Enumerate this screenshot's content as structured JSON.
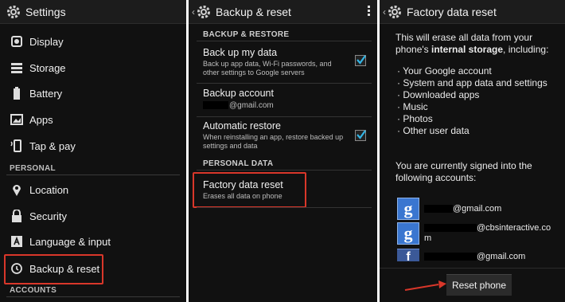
{
  "settings": {
    "title": "Settings",
    "items_top": [
      {
        "label": "Display",
        "icon": "display-icon"
      },
      {
        "label": "Storage",
        "icon": "storage-icon"
      },
      {
        "label": "Battery",
        "icon": "battery-icon"
      },
      {
        "label": "Apps",
        "icon": "apps-icon"
      },
      {
        "label": "Tap & pay",
        "icon": "tap-pay-icon"
      }
    ],
    "personal_header": "PERSONAL",
    "items_personal": [
      {
        "label": "Location",
        "icon": "location-icon"
      },
      {
        "label": "Security",
        "icon": "lock-icon"
      },
      {
        "label": "Language & input",
        "icon": "language-icon"
      },
      {
        "label": "Backup & reset",
        "icon": "backup-restore-icon"
      }
    ],
    "accounts_header": "ACCOUNTS"
  },
  "backup": {
    "title": "Backup & reset",
    "section1": "BACKUP & RESTORE",
    "backup_data": {
      "title": "Back up my data",
      "summary": "Back up app data, Wi-Fi passwords, and other settings to Google servers",
      "checked": true
    },
    "backup_account": {
      "title": "Backup account",
      "email_suffix": "@gmail.com"
    },
    "auto_restore": {
      "title": "Automatic restore",
      "summary": "When reinstalling an app, restore backed up settings and data",
      "checked": true
    },
    "section2": "PERSONAL DATA",
    "factory_reset": {
      "title": "Factory data reset",
      "summary": "Erases all data on phone"
    }
  },
  "factory": {
    "title": "Factory data reset",
    "intro_line1": "This will erase all data from your",
    "intro_line2_a": "phone's ",
    "intro_line2_b": "internal storage",
    "intro_line2_c": ", including:",
    "list": [
      "· Your Google account",
      "· System and app data and settings",
      "· Downloaded apps",
      "· Music",
      "· Photos",
      "· Other user data"
    ],
    "signed_in_1": "You are currently signed into the",
    "signed_in_2": "following accounts:",
    "accounts": [
      {
        "type": "google",
        "icon_letter": "g",
        "email_suffix": "@gmail.com"
      },
      {
        "type": "google",
        "icon_letter": "g",
        "email_suffix": "@cbsinteractive.co",
        "email_line2": "m"
      },
      {
        "type": "facebook",
        "icon_letter": "f",
        "email_suffix": "@gmail.com"
      }
    ],
    "reset_button": "Reset phone"
  },
  "colors": {
    "highlight": "#d9372a",
    "checkbox": "#33b5e5",
    "panel_bg": "#111111"
  }
}
